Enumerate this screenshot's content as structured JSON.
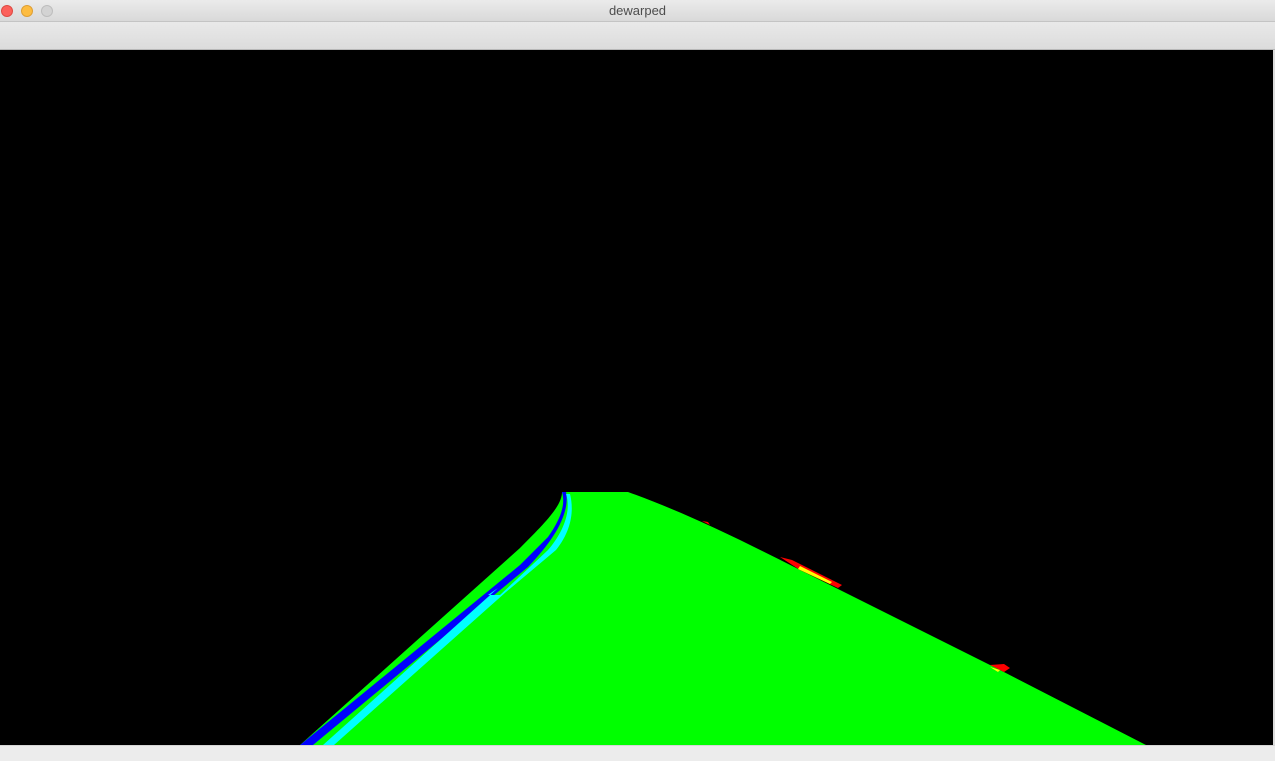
{
  "window": {
    "title": "dewarped"
  },
  "colors": {
    "background": "#000000",
    "lane_fill": "#00ff00",
    "left_line_outer": "#0000ff",
    "left_line_inner": "#00ffff",
    "right_line_marks": "#ff0000",
    "right_line_highlight": "#ffff00"
  },
  "controls": {
    "close": "close-button",
    "minimize": "minimize-button",
    "zoom": "zoom-button"
  }
}
